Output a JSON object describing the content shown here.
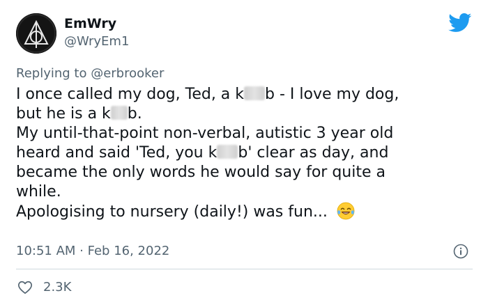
{
  "author": {
    "display_name": "EmWry",
    "handle": "@WryEm1",
    "avatar_icon": "deathly-hallows-icon"
  },
  "brand": {
    "logo_icon": "twitter-bird-icon",
    "accent_color": "#1d9bf0"
  },
  "reply": {
    "prefix": "Replying to ",
    "user": "@erbrooker"
  },
  "tweet": {
    "segments": {
      "s1a": "I once called my dog, Ted, a k",
      "s1b": "b - I love my dog,",
      "s2a": "but he is a k",
      "s2b": "b.",
      "s3": "My until-that-point non-verbal, autistic 3 year old",
      "s4a": "heard and said 'Ted, you k",
      "s4b": "b' clear as day, and",
      "s5": "became the only words he would say for quite a",
      "s6": "while.",
      "s7": "Apologising to nursery (daily!) was fun... "
    },
    "emoji": "face-with-tears-of-joy-icon"
  },
  "meta": {
    "timestamp": "10:51 AM · Feb 16, 2022",
    "info_icon": "info-icon"
  },
  "engagement": {
    "like_icon": "heart-icon",
    "like_count": "2.3K"
  }
}
